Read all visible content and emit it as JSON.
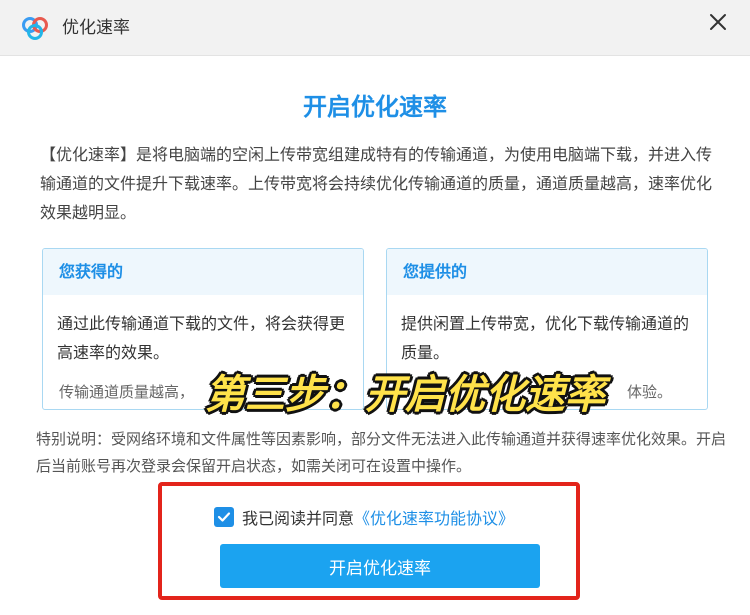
{
  "window": {
    "title": "优化速率",
    "logo_icon": "cloud-logo-icon",
    "close_icon": "close-icon"
  },
  "main": {
    "heading": "开启优化速率",
    "intro": "【优化速率】是将电脑端的空闲上传带宽组建成特有的传输通道，为使用电脑端下载，并进入传输通道的文件提升下载速率。上传带宽将会持续优化传输通道的质量，通道质量越高，速率优化效果越明显。",
    "cards": [
      {
        "title": "您获得的",
        "body": "通过此传输通道下载的文件，将会获得更高速率的效果。",
        "footer": "传输通道质量越高，"
      },
      {
        "title": "您提供的",
        "body": "提供闲置上传带宽，优化下载传输通道的质量。",
        "footer": "体验。"
      }
    ],
    "overlay_caption": "第三步：开启优化速率",
    "note": "特别说明：受网络环境和文件属性等因素影响，部分文件无法进入此传输通道并获得速率优化效果。开启后当前账号再次登录会保留开启状态，如需关闭可在设置中操作。"
  },
  "agreement": {
    "checked": true,
    "text": "我已阅读并同意",
    "link": "《优化速率功能协议》"
  },
  "action": {
    "button_label": "开启优化速率"
  },
  "colors": {
    "accent": "#1e8fe6",
    "button": "#1ba3f0",
    "highlight": "#e3241b",
    "caption": "#ffe24a"
  }
}
